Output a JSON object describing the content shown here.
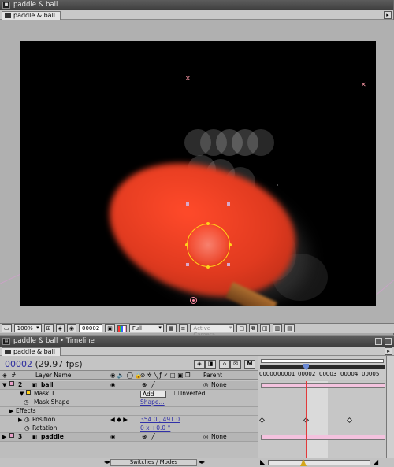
{
  "comp_window": {
    "title": "paddle & ball",
    "tab_label": "paddle & ball",
    "toolbar": {
      "zoom": "100%",
      "timecode": "00002",
      "resolution": "Full",
      "camera": "Active Camera"
    }
  },
  "timeline_window": {
    "title": "paddle & ball • Timeline",
    "tab_label": "paddle & ball",
    "timecode": "00002",
    "fps": "(29.97 fps)",
    "columns": {
      "layer_name": "Layer Name",
      "parent": "Parent"
    },
    "ruler_labels": [
      "00000",
      "00001",
      "00002",
      "00003",
      "00004",
      "00005"
    ],
    "layers": [
      {
        "index": "2",
        "name": "ball",
        "parent": "None",
        "label_color": "#e8a0c8"
      },
      {
        "index": "3",
        "name": "paddle",
        "parent": "None",
        "label_color": "#e8a0c8"
      }
    ],
    "mask": {
      "name": "Mask 1",
      "mode": "Add",
      "inverted_label": "Inverted",
      "shape_label": "Mask Shape",
      "shape_value": "Shape..."
    },
    "effects_label": "Effects",
    "position": {
      "label": "Position",
      "value": "354.0 , 491.0"
    },
    "rotation": {
      "label": "Rotation",
      "value": "0 x +0.0 °"
    },
    "footer": {
      "switches_modes": "Switches / Modes"
    }
  }
}
